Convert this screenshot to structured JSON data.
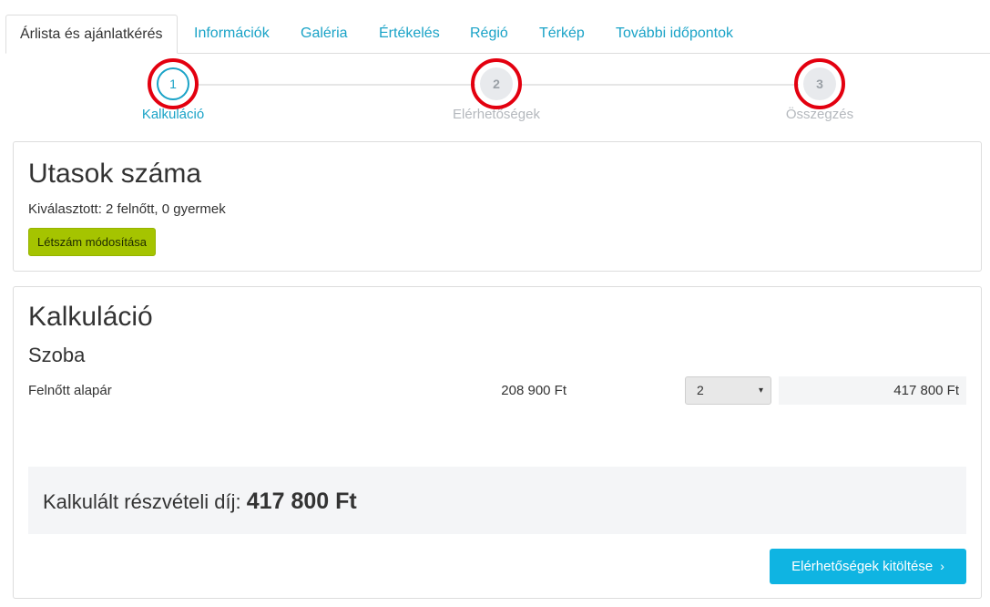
{
  "tabs": [
    {
      "label": "Árlista és ajánlatkérés",
      "active": true
    },
    {
      "label": "Információk"
    },
    {
      "label": "Galéria"
    },
    {
      "label": "Értékelés"
    },
    {
      "label": "Régió"
    },
    {
      "label": "Térkép"
    },
    {
      "label": "További időpontok"
    }
  ],
  "stepper": {
    "steps": [
      {
        "number": "1",
        "label": "Kalkuláció",
        "active": true
      },
      {
        "number": "2",
        "label": "Elérhetőségek"
      },
      {
        "number": "3",
        "label": "Összegzés"
      }
    ]
  },
  "passengers": {
    "title": "Utasok száma",
    "selected": "Kiválasztott: 2 felnőtt, 0 gyermek",
    "modify_button": "Létszám módosítása"
  },
  "calculation": {
    "title": "Kalkuláció",
    "room_title": "Szoba",
    "rows": [
      {
        "label": "Felnőtt alapár",
        "unit_price": "208 900 Ft",
        "quantity": "2",
        "total": "417 800 Ft"
      }
    ],
    "total_label": "Kalkulált részvételi díj:",
    "total_value": "417 800 Ft",
    "next_button": "Elérhetőségek kitöltése"
  },
  "colors": {
    "accent": "#1aa3c7",
    "lime_button": "#a5c400",
    "cyan_button": "#0fb4e2",
    "highlight_ring": "#e3000f"
  },
  "icons": {
    "select_arrow": "▾",
    "next_chevron": "›"
  }
}
